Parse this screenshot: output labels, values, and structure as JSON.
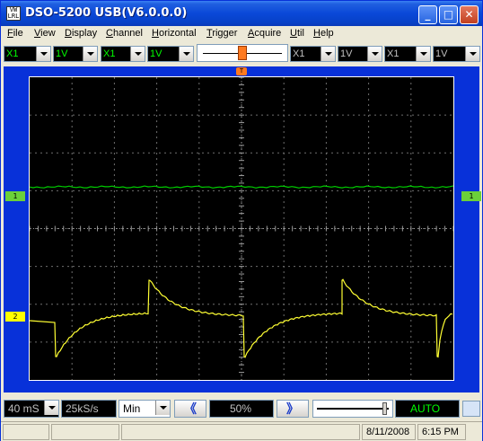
{
  "window": {
    "title": "DSO-5200 USB(V6.0.0.0)"
  },
  "titlebar": {
    "minimize": "_",
    "maximize": "□",
    "close": "✕",
    "app_icon_text": "VW\nLRL"
  },
  "menu": [
    "File",
    "View",
    "Display",
    "Channel",
    "Horizontal",
    "Trigger",
    "Acquire",
    "Util",
    "Help"
  ],
  "controls": {
    "ch1_probe": "X1",
    "ch1_volts": "1V",
    "ch2_probe": "X1",
    "ch2_volts": "1V",
    "ch3_probe": "X1",
    "ch3_volts": "1V",
    "ch4_probe": "X1",
    "ch4_volts": "1V"
  },
  "channels": [
    {
      "label": "1",
      "color": "#6BD03A"
    },
    {
      "label": "2",
      "color": "#FFFF00"
    }
  ],
  "trigger_marker": "T",
  "bottom": {
    "timebase": "40 mS",
    "sample_rate": "25kS/s",
    "acq_mode": "Min",
    "prev": "《",
    "position": "50%",
    "next": "》",
    "run_mode": "AUTO"
  },
  "status": {
    "date": "8/11/2008",
    "time": "6:15 PM"
  },
  "colors": {
    "trace1": "#00CC00",
    "trace2": "#FFFF33",
    "grid": "#6E6E6E",
    "title_bar": "#0A48D8"
  }
}
